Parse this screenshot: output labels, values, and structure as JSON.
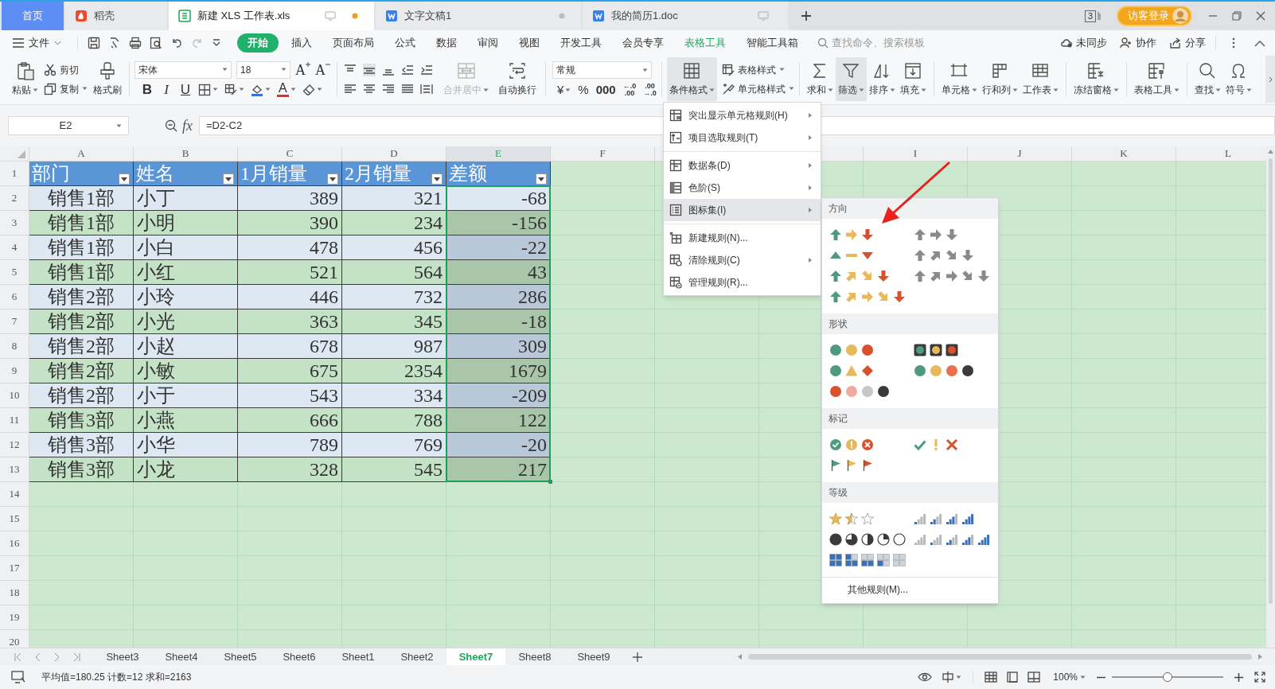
{
  "window_tabs": [
    {
      "label": "首页",
      "kind": "home",
      "selected": false,
      "unsaved": false
    },
    {
      "label": "稻壳",
      "kind": "docer",
      "selected": false,
      "unsaved": false
    },
    {
      "label": "新建 XLS 工作表.xls",
      "kind": "sheet",
      "selected": true,
      "unsaved": true
    },
    {
      "label": "文字文稿1",
      "kind": "doc",
      "selected": false,
      "unsaved": true
    },
    {
      "label": "我的简历1.doc",
      "kind": "doc",
      "selected": false,
      "unsaved": false
    }
  ],
  "window_count": "3",
  "login_button": "访客登录",
  "file_menu": "文件",
  "menu_tabs": [
    {
      "label": "开始",
      "selected": true,
      "kind": "main"
    },
    {
      "label": "插入",
      "selected": false,
      "kind": "main"
    },
    {
      "label": "页面布局",
      "selected": false,
      "kind": "main"
    },
    {
      "label": "公式",
      "selected": false,
      "kind": "main"
    },
    {
      "label": "数据",
      "selected": false,
      "kind": "main"
    },
    {
      "label": "审阅",
      "selected": false,
      "kind": "main"
    },
    {
      "label": "视图",
      "selected": false,
      "kind": "main"
    },
    {
      "label": "开发工具",
      "selected": false,
      "kind": "main"
    },
    {
      "label": "会员专享",
      "selected": false,
      "kind": "main"
    },
    {
      "label": "表格工具",
      "selected": false,
      "kind": "context"
    },
    {
      "label": "智能工具箱",
      "selected": false,
      "kind": "main"
    }
  ],
  "search": {
    "placeholder": "查找命令、搜索模板"
  },
  "cloud_actions": [
    "未同步",
    "协作",
    "分享"
  ],
  "ribbon": {
    "paste": {
      "label": "粘贴",
      "dropdown": true
    },
    "clip_small": [
      {
        "label": "剪切",
        "dropdown": false
      },
      {
        "label": "复制",
        "dropdown": true
      }
    ],
    "format_painter": {
      "label": "格式刷"
    },
    "font": {
      "name": "宋体",
      "size": "18"
    },
    "font_size_buttons": [
      "A",
      "A"
    ],
    "font_style_buttons": [
      "B",
      "I",
      "U"
    ],
    "font_color_letter": "A",
    "merge_wrap": [
      {
        "label": "合并居中",
        "disabled": true,
        "dropdown": true
      },
      {
        "label": "自动换行",
        "disabled": false,
        "dropdown": false
      }
    ],
    "number_format": "常规",
    "number_buttons": [
      "¥",
      "%",
      "000"
    ],
    "decimal_buttons": [
      {
        "top": "←.0",
        "bottom": ".00"
      },
      {
        "top": ".00",
        "bottom": "→.0"
      }
    ],
    "conditional_format": {
      "label": "条件格式",
      "pressed": true
    },
    "style_buttons": [
      "表格样式",
      "单元格样式"
    ],
    "tools": [
      {
        "label": "求和",
        "pressed": false
      },
      {
        "label": "筛选",
        "pressed": true
      },
      {
        "label": "排序",
        "pressed": false
      },
      {
        "label": "填充",
        "pressed": false
      },
      {
        "label": "单元格",
        "pressed": false
      },
      {
        "label": "行和列",
        "pressed": false
      },
      {
        "label": "工作表",
        "pressed": false
      },
      {
        "label": "冻结窗格",
        "pressed": false
      },
      {
        "label": "表格工具",
        "pressed": false
      },
      {
        "label": "查找",
        "pressed": false
      },
      {
        "label": "符号",
        "pressed": false
      }
    ]
  },
  "formula_bar": {
    "name_box": "E2",
    "fx": "fx",
    "formula": "=D2-C2"
  },
  "sheet": {
    "columns": [
      {
        "label": "A",
        "selected": false
      },
      {
        "label": "B",
        "selected": false
      },
      {
        "label": "C",
        "selected": false
      },
      {
        "label": "D",
        "selected": false
      },
      {
        "label": "E",
        "selected": true
      },
      {
        "label": "F",
        "selected": false
      },
      {
        "label": "I",
        "selected": false
      },
      {
        "label": "J",
        "selected": false
      },
      {
        "label": "K",
        "selected": false
      },
      {
        "label": "L",
        "selected": false
      }
    ],
    "row_numbers": [
      "1",
      "2",
      "3",
      "4",
      "5",
      "6",
      "7",
      "8",
      "9",
      "10",
      "11",
      "12",
      "13",
      "14",
      "15",
      "16",
      "17",
      "18",
      "19",
      "20"
    ],
    "table": {
      "headers": [
        "部门",
        "姓名",
        "1月销量",
        "2月销量",
        "差额"
      ],
      "rows": [
        [
          "销售1部",
          "小丁",
          "389",
          "321",
          "-68"
        ],
        [
          "销售1部",
          "小明",
          "390",
          "234",
          "-156"
        ],
        [
          "销售1部",
          "小白",
          "478",
          "456",
          "-22"
        ],
        [
          "销售1部",
          "小红",
          "521",
          "564",
          "43"
        ],
        [
          "销售2部",
          "小玲",
          "446",
          "732",
          "286"
        ],
        [
          "销售2部",
          "小光",
          "363",
          "345",
          "-18"
        ],
        [
          "销售2部",
          "小赵",
          "678",
          "987",
          "309"
        ],
        [
          "销售2部",
          "小敏",
          "675",
          "2354",
          "1679"
        ],
        [
          "销售2部",
          "小于",
          "543",
          "334",
          "-209"
        ],
        [
          "销售3部",
          "小燕",
          "666",
          "788",
          "122"
        ],
        [
          "销售3部",
          "小华",
          "789",
          "769",
          "-20"
        ],
        [
          "销售3部",
          "小龙",
          "328",
          "545",
          "217"
        ]
      ]
    }
  },
  "conditional_format_menu": {
    "groups": [
      [
        {
          "label": "突出显示单元格规则(H)",
          "submenu": true,
          "selected": false
        },
        {
          "label": "项目选取规则(T)",
          "submenu": true,
          "selected": false
        }
      ],
      [
        {
          "label": "数据条(D)",
          "submenu": true,
          "selected": false
        },
        {
          "label": "色阶(S)",
          "submenu": true,
          "selected": false
        },
        {
          "label": "图标集(I)",
          "submenu": true,
          "selected": true
        }
      ],
      [
        {
          "label": "新建规则(N)...",
          "submenu": false,
          "selected": false
        },
        {
          "label": "清除规则(C)",
          "submenu": true,
          "selected": false
        },
        {
          "label": "管理规则(R)...",
          "submenu": false,
          "selected": false
        }
      ]
    ]
  },
  "icon_sets_menu": {
    "sections": [
      {
        "title": "方向",
        "kind": "direction"
      },
      {
        "title": "形状",
        "kind": "shape"
      },
      {
        "title": "标记",
        "kind": "mark"
      },
      {
        "title": "等级",
        "kind": "rating"
      }
    ],
    "footer": "其他规则(M)..."
  },
  "sheet_tabs": [
    {
      "label": "Sheet3",
      "selected": false
    },
    {
      "label": "Sheet4",
      "selected": false
    },
    {
      "label": "Sheet5",
      "selected": false
    },
    {
      "label": "Sheet6",
      "selected": false
    },
    {
      "label": "Sheet1",
      "selected": false
    },
    {
      "label": "Sheet2",
      "selected": false
    },
    {
      "label": "Sheet7",
      "selected": true
    },
    {
      "label": "Sheet8",
      "selected": false
    },
    {
      "label": "Sheet9",
      "selected": false
    }
  ],
  "status_bar": {
    "summary": "平均值=180.25 计数=12 求和=2163",
    "zoom": "100%",
    "zoom_slider": {
      "level": 0.5
    }
  }
}
